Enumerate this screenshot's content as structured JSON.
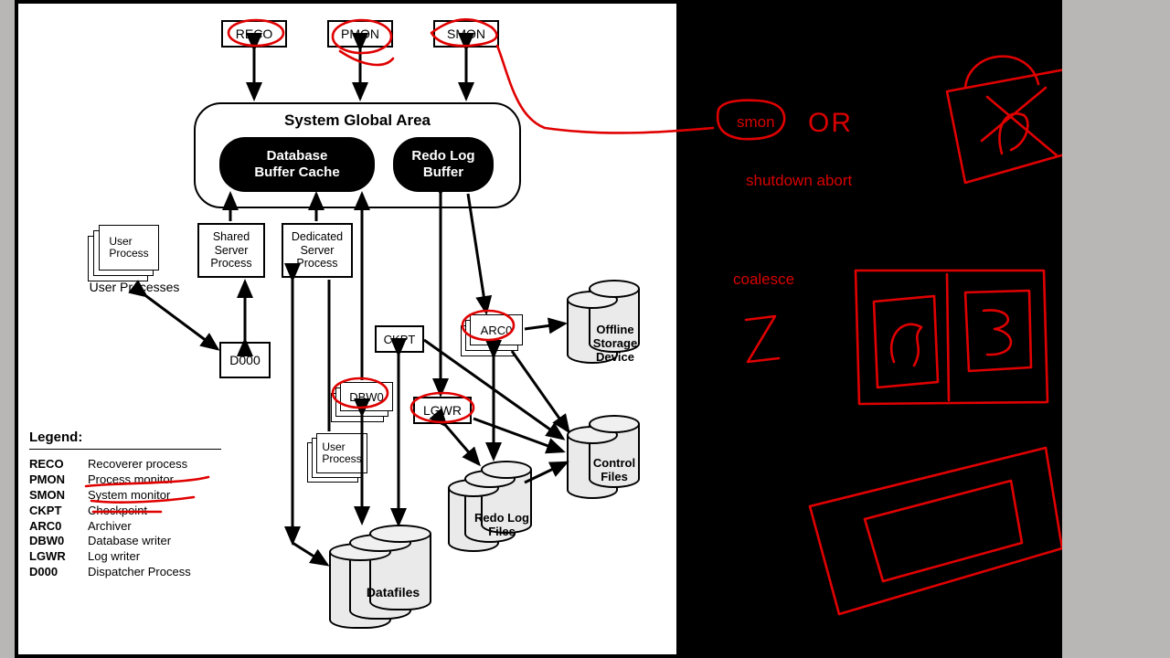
{
  "top_processes": {
    "reco": "RECO",
    "pmon": "PMON",
    "smon": "SMON"
  },
  "sga": {
    "title": "System Global Area",
    "buffer_cache": "Database\nBuffer Cache",
    "redo_buffer": "Redo Log\nBuffer"
  },
  "user_process_stack": "User\nProcess",
  "user_processes_caption": "User Processes",
  "shared_server": "Shared\nServer\nProcess",
  "dedicated_server": "Dedicated\nServer\nProcess",
  "d000": "D000",
  "ckpt": "CKPT",
  "arc0": "ARC0",
  "dbw0": "DBW0",
  "lgwr": "LGWR",
  "user_process_small": "User\nProcess",
  "cylinders": {
    "offline": "Offline\nStorage\nDevice",
    "control": "Control\nFiles",
    "redo": "Redo Log\nFiles",
    "datafiles": "Datafiles"
  },
  "legend": {
    "title": "Legend:",
    "rows": [
      {
        "k": "RECO",
        "v": "Recoverer process"
      },
      {
        "k": "PMON",
        "v": "Process monitor"
      },
      {
        "k": "SMON",
        "v": "System monitor"
      },
      {
        "k": "CKPT",
        "v": "Checkpoint"
      },
      {
        "k": "ARC0",
        "v": "Archiver"
      },
      {
        "k": "DBW0",
        "v": "Database writer"
      },
      {
        "k": "LGWR",
        "v": "Log writer"
      },
      {
        "k": "D000",
        "v": "Dispatcher Process"
      }
    ]
  },
  "annotations": {
    "smon": "smon",
    "or": "OR",
    "shutdown": "shutdown abort",
    "coalesce": "coalesce"
  }
}
